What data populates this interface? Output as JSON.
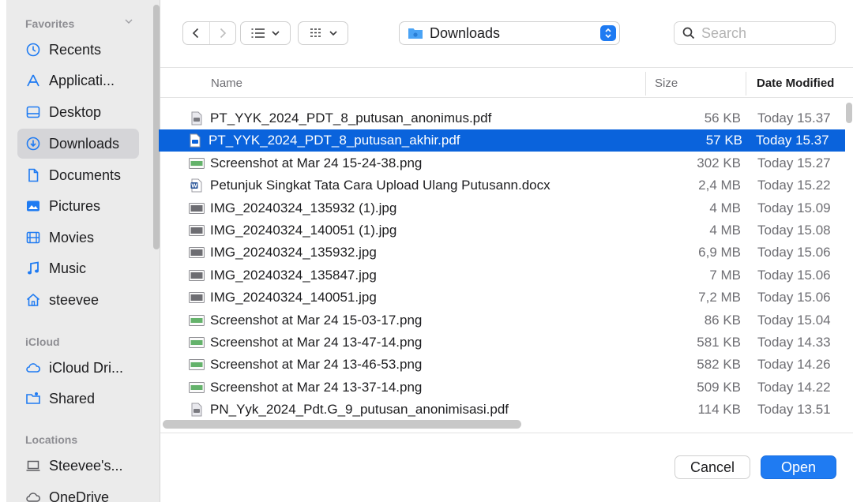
{
  "sidebar": {
    "favorites_label": "Favorites",
    "icloud_label": "iCloud",
    "locations_label": "Locations",
    "favorites": [
      {
        "label": "Recents",
        "icon": "clock-icon"
      },
      {
        "label": "Applicati...",
        "icon": "applications-icon"
      },
      {
        "label": "Desktop",
        "icon": "desktop-icon"
      },
      {
        "label": "Downloads",
        "icon": "download-icon",
        "active": true
      },
      {
        "label": "Documents",
        "icon": "document-icon"
      },
      {
        "label": "Pictures",
        "icon": "pictures-icon"
      },
      {
        "label": "Movies",
        "icon": "film-icon"
      },
      {
        "label": "Music",
        "icon": "music-note-icon"
      },
      {
        "label": "steevee",
        "icon": "home-icon"
      }
    ],
    "icloud": [
      {
        "label": "iCloud Dri...",
        "icon": "cloud-icon"
      },
      {
        "label": "Shared",
        "icon": "shared-folder-icon"
      }
    ],
    "locations": [
      {
        "label": "Steevee's...",
        "icon": "laptop-icon"
      },
      {
        "label": "OneDrive",
        "icon": "cloud-icon"
      }
    ]
  },
  "toolbar": {
    "location": "Downloads",
    "search_placeholder": "Search"
  },
  "columns": {
    "name": "Name",
    "size": "Size",
    "date": "Date Modified"
  },
  "files": [
    {
      "name": "PT_YYK_2024_PDT_8_putusan_anonimus.pdf",
      "size": "56 KB",
      "date": "Today 15.37",
      "type": "pdf"
    },
    {
      "name": "PT_YYK_2024_PDT_8_putusan_akhir.pdf",
      "size": "57 KB",
      "date": "Today 15.37",
      "type": "pdf",
      "selected": true
    },
    {
      "name": "Screenshot at Mar 24 15-24-38.png",
      "size": "302 KB",
      "date": "Today 15.27",
      "type": "png"
    },
    {
      "name": "Petunjuk Singkat Tata Cara Upload Ulang Putusann.docx",
      "size": "2,4 MB",
      "date": "Today 15.22",
      "type": "docx"
    },
    {
      "name": "IMG_20240324_135932 (1).jpg",
      "size": "4 MB",
      "date": "Today 15.09",
      "type": "jpg"
    },
    {
      "name": "IMG_20240324_140051 (1).jpg",
      "size": "4 MB",
      "date": "Today 15.08",
      "type": "jpg"
    },
    {
      "name": "IMG_20240324_135932.jpg",
      "size": "6,9 MB",
      "date": "Today 15.06",
      "type": "jpg"
    },
    {
      "name": "IMG_20240324_135847.jpg",
      "size": "7 MB",
      "date": "Today 15.06",
      "type": "jpg"
    },
    {
      "name": "IMG_20240324_140051.jpg",
      "size": "7,2 MB",
      "date": "Today 15.06",
      "type": "jpg"
    },
    {
      "name": "Screenshot at Mar 24 15-03-17.png",
      "size": "86 KB",
      "date": "Today 15.04",
      "type": "png"
    },
    {
      "name": "Screenshot at Mar 24 13-47-14.png",
      "size": "581 KB",
      "date": "Today 14.33",
      "type": "png"
    },
    {
      "name": "Screenshot at Mar 24 13-46-53.png",
      "size": "582 KB",
      "date": "Today 14.26",
      "type": "png"
    },
    {
      "name": "Screenshot at Mar 24 13-37-14.png",
      "size": "509 KB",
      "date": "Today 14.22",
      "type": "png"
    },
    {
      "name": "PN_Yyk_2024_Pdt.G_9_putusan_anonimisasi.pdf",
      "size": "114 KB",
      "date": "Today 13.51",
      "type": "pdf"
    }
  ],
  "footer": {
    "cancel_label": "Cancel",
    "open_label": "Open"
  },
  "colors": {
    "accent": "#1f7bf2",
    "selection": "#0a63dc",
    "sidebar_bg": "#ebebeb"
  }
}
